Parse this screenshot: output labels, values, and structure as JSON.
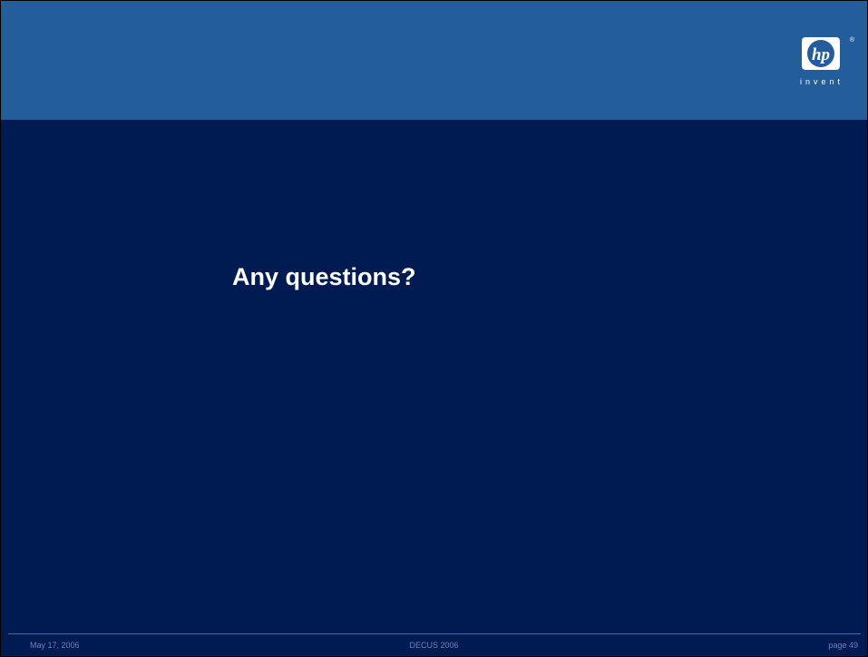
{
  "slide": {
    "title": "Any questions?",
    "logo": {
      "mark": "hp",
      "registered": "®",
      "tagline": "invent",
      "icon": "hp-logo-icon"
    },
    "footer": {
      "date": "May 17, 2006",
      "event": "DECUS 2006",
      "page": "page 49"
    }
  },
  "colors": {
    "background": "#001a52",
    "header": "#235e9a",
    "title_text": "#ffffff",
    "footer_text": "#5f86c4"
  }
}
